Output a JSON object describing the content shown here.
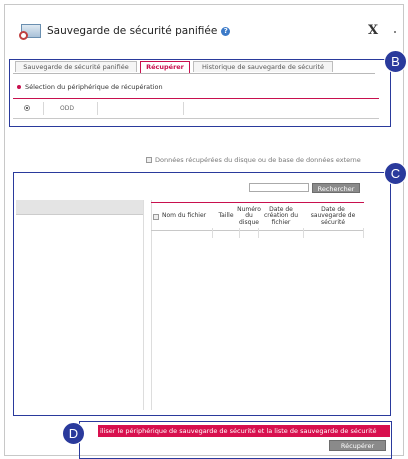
{
  "window": {
    "title": "Sauvegarde de sécurité panifiée",
    "close_label": "X"
  },
  "tabs": [
    {
      "label": "Sauvegarde de sécurité panifiée",
      "active": false
    },
    {
      "label": "Récupérer",
      "active": true
    },
    {
      "label": "Historique de sauvegarde de sécurité",
      "active": false
    }
  ],
  "recovery_device": {
    "section_title": "Sélection du périphérique de récupération",
    "rows": [
      {
        "selected": true,
        "name": "ODD"
      }
    ]
  },
  "external": {
    "checkbox_label": "Données récupérées du disque ou de base de données externe",
    "checked": false
  },
  "search": {
    "value": "",
    "button_label": "Rechercher"
  },
  "file_table": {
    "columns": [
      "Nom du fichier",
      "Taille",
      "Numéro du disque",
      "Date de création du fichier",
      "Date de sauvegarde de sécurité"
    ]
  },
  "footer": {
    "message": "iliser le périphérique de sauvegarde de sécurité et la liste de sauvegarde de sécurité",
    "recover_label": "Récupérer"
  },
  "callouts": {
    "b": "B",
    "c": "C",
    "d": "D"
  },
  "colors": {
    "accent": "#c8104e",
    "callout": "#2a3a9c",
    "button": "#8a8a8a"
  }
}
